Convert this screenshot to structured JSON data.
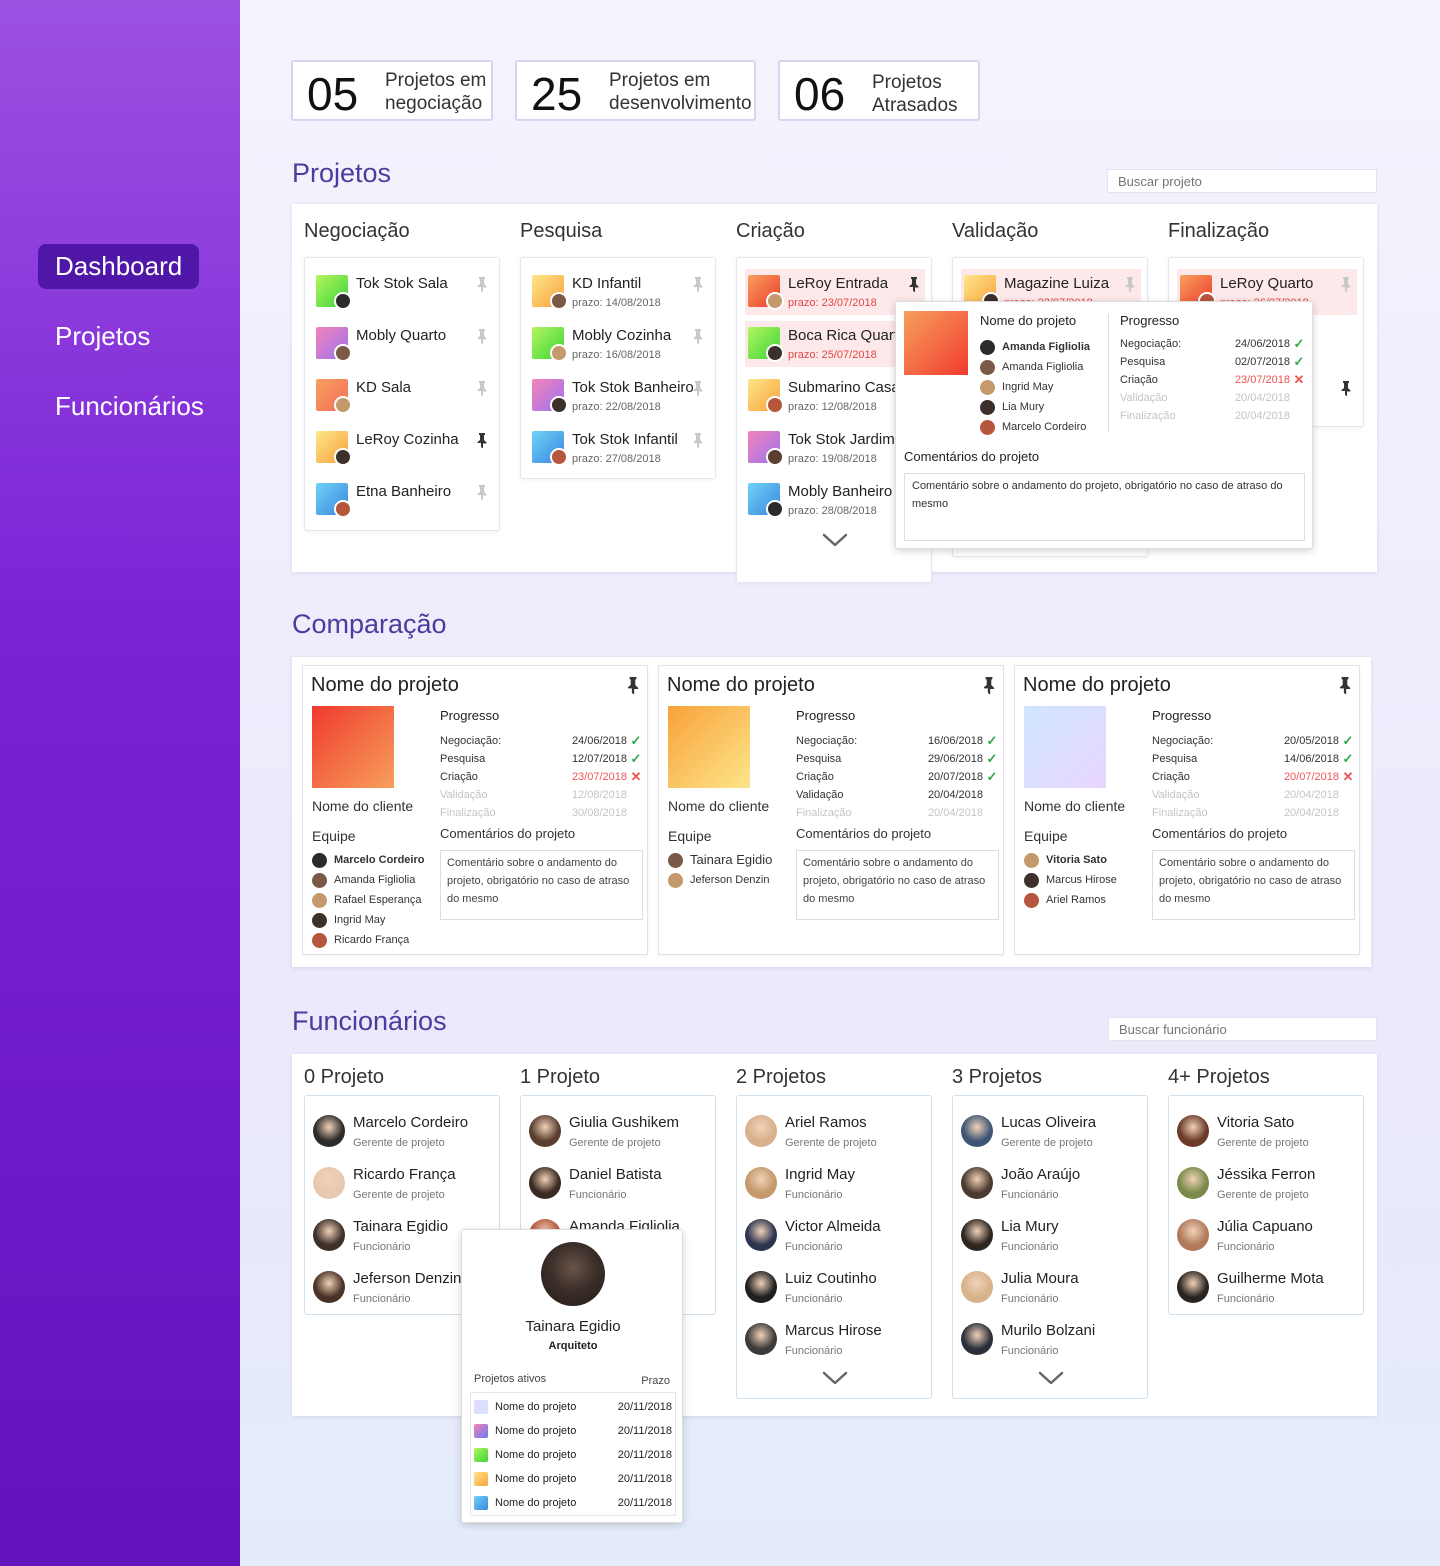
{
  "sidebar": {
    "items": [
      {
        "label": "Dashboard",
        "active": true
      },
      {
        "label": "Projetos",
        "active": false
      },
      {
        "label": "Funcionários",
        "active": false
      }
    ]
  },
  "stats": [
    {
      "value": "05",
      "label": "Projetos em\nnegociação"
    },
    {
      "value": "25",
      "label": "Projetos em\ndesenvolvimento"
    },
    {
      "value": "06",
      "label": "Projetos\nAtrasados"
    }
  ],
  "projetos": {
    "title": "Projetos",
    "search_placeholder": "Buscar projeto",
    "columns": [
      {
        "title": "Negociação",
        "items": [
          {
            "name": "Tok Stok Sala",
            "date": "",
            "late": false,
            "pinned": false,
            "thumb": "#b4f55e",
            "thumb2": "#3dd43b"
          },
          {
            "name": "Mobly Quarto",
            "date": "",
            "late": false,
            "pinned": false,
            "thumb": "#f583b8",
            "thumb2": "#9b73f0"
          },
          {
            "name": "KD Sala",
            "date": "",
            "late": false,
            "pinned": false,
            "thumb": "#f7a05c",
            "thumb2": "#f26d5b"
          },
          {
            "name": "LeRoy Cozinha",
            "date": "",
            "late": false,
            "pinned": true,
            "thumb": "#fde68a",
            "thumb2": "#f9a13a"
          },
          {
            "name": "Etna Banheiro",
            "date": "",
            "late": false,
            "pinned": false,
            "thumb": "#6fd3f5",
            "thumb2": "#3a86e0"
          }
        ]
      },
      {
        "title": "Pesquisa",
        "items": [
          {
            "name": "KD Infantil",
            "date": "prazo: 14/08/2018",
            "late": false,
            "pinned": false,
            "thumb": "#fde68a",
            "thumb2": "#f9a13a"
          },
          {
            "name": "Mobly Cozinha",
            "date": "prazo: 16/08/2018",
            "late": false,
            "pinned": false,
            "thumb": "#b4f55e",
            "thumb2": "#3dd43b"
          },
          {
            "name": "Tok Stok Banheiro",
            "date": "prazo: 22/08/2018",
            "late": false,
            "pinned": false,
            "thumb": "#f583b8",
            "thumb2": "#9b73f0"
          },
          {
            "name": "Tok Stok Infantil",
            "date": "prazo: 27/08/2018",
            "late": false,
            "pinned": false,
            "thumb": "#6fd3f5",
            "thumb2": "#3a86e0"
          }
        ]
      },
      {
        "title": "Criação",
        "items": [
          {
            "name": "LeRoy Entrada",
            "date": "prazo: 23/07/2018",
            "late": true,
            "pinned": true,
            "thumb": "#f7a05c",
            "thumb2": "#f03a2e"
          },
          {
            "name": "Boca Rica Quarto",
            "date": "prazo: 25/07/2018",
            "late": true,
            "pinned": false,
            "thumb": "#b4f55e",
            "thumb2": "#3dd43b"
          },
          {
            "name": "Submarino Casa",
            "date": "prazo: 12/08/2018",
            "late": false,
            "pinned": false,
            "thumb": "#fde68a",
            "thumb2": "#f9a13a"
          },
          {
            "name": "Tok Stok Jardim",
            "date": "prazo: 19/08/2018",
            "late": false,
            "pinned": false,
            "thumb": "#f583b8",
            "thumb2": "#9b73f0"
          },
          {
            "name": "Mobly Banheiro",
            "date": "prazo: 28/08/2018",
            "late": false,
            "pinned": false,
            "thumb": "#6fd3f5",
            "thumb2": "#3a86e0"
          }
        ]
      },
      {
        "title": "Validação",
        "items": [
          {
            "name": "Magazine Luiza",
            "date": "prazo: 22/07/2018",
            "late": true,
            "pinned": false,
            "thumb": "#fde68a",
            "thumb2": "#f9a13a"
          }
        ]
      },
      {
        "title": "Finalização",
        "items": [
          {
            "name": "LeRoy Quarto",
            "date": "prazo: 26/07/2018",
            "late": true,
            "pinned": false,
            "thumb": "#f7a05c",
            "thumb2": "#f03a2e"
          },
          {
            "name": "",
            "date": "",
            "late": false,
            "pinned": false,
            "thumb": "#ffffff",
            "thumb2": "#ffffff"
          },
          {
            "name": "…ala",
            "date": "",
            "late": false,
            "pinned": true,
            "thumb": "#ffffff",
            "thumb2": "#ffffff"
          }
        ]
      }
    ],
    "popup": {
      "name_label": "Nome do projeto",
      "team": [
        {
          "name": "Amanda Figliolia",
          "bold": true
        },
        {
          "name": "Amanda Figliolia",
          "bold": false
        },
        {
          "name": "Ingrid May",
          "bold": false
        },
        {
          "name": "Lia Mury",
          "bold": false
        },
        {
          "name": "Marcelo Cordeiro",
          "bold": false
        }
      ],
      "progress_label": "Progresso",
      "progress": [
        {
          "step": "Negociação:",
          "date": "24/06/2018",
          "status": "ok"
        },
        {
          "step": "Pesquisa",
          "date": "02/07/2018",
          "status": "ok"
        },
        {
          "step": "Criação",
          "date": "23/07/2018",
          "status": "late"
        },
        {
          "step": "Validação",
          "date": "20/04/2018",
          "status": "pending"
        },
        {
          "step": "Finalização",
          "date": "20/04/2018",
          "status": "pending"
        }
      ],
      "comments_label": "Comentários do projeto",
      "comment": "Comentário sobre o andamento do projeto, obrigatório no caso de atraso do mesmo"
    }
  },
  "comparacao": {
    "title": "Comparação",
    "cards": [
      {
        "name": "Nome do projeto",
        "client": "Nome do cliente",
        "team_label": "Equipe",
        "progress_label": "Progresso",
        "comments_label": "Comentários do projeto",
        "thumb": "#f7a05c",
        "thumb2": "#f03a2e",
        "progress": [
          {
            "step": "Negociação:",
            "date": "24/06/2018",
            "status": "ok"
          },
          {
            "step": "Pesquisa",
            "date": "12/07/2018",
            "status": "ok"
          },
          {
            "step": "Criação",
            "date": "23/07/2018",
            "status": "late"
          },
          {
            "step": "Validação",
            "date": "12/08/2018",
            "status": "pending"
          },
          {
            "step": "Finalização",
            "date": "30/08/2018",
            "status": "pending"
          }
        ],
        "team": [
          {
            "name": "Marcelo Cordeiro",
            "bold": true
          },
          {
            "name": "Amanda Figliolia",
            "bold": false
          },
          {
            "name": "Rafael Esperança",
            "bold": false
          },
          {
            "name": "Ingrid May",
            "bold": false
          },
          {
            "name": "Ricardo França",
            "bold": false
          }
        ],
        "comment": "Comentário sobre o andamento do projeto, obrigatório no caso de atraso do mesmo"
      },
      {
        "name": "Nome do projeto",
        "client": "Nome do cliente",
        "team_label": "Equipe",
        "progress_label": "Progresso",
        "comments_label": "Comentários do projeto",
        "thumb": "#fde68a",
        "thumb2": "#f9a13a",
        "progress": [
          {
            "step": "Negociação:",
            "date": "16/06/2018",
            "status": "ok"
          },
          {
            "step": "Pesquisa",
            "date": "29/06/2018",
            "status": "ok"
          },
          {
            "step": "Criação",
            "date": "20/07/2018",
            "status": "ok"
          },
          {
            "step": "Validação",
            "date": "20/04/2018",
            "status": "active"
          },
          {
            "step": "Finalização",
            "date": "20/04/2018",
            "status": "pending"
          }
        ],
        "team": [
          {
            "name": "Tainara Egidio",
            "bold": false
          },
          {
            "name": "Jeferson Denzin",
            "bold": false
          }
        ],
        "comment": "Comentário sobre o andamento do projeto, obrigatório no caso de atraso do mesmo"
      },
      {
        "name": "Nome do projeto",
        "client": "Nome do cliente",
        "team_label": "Equipe",
        "progress_label": "Progresso",
        "comments_label": "Comentários do projeto",
        "thumb": "#e8d6ff",
        "thumb2": "#cfe6ff",
        "progress": [
          {
            "step": "Negociação:",
            "date": "20/05/2018",
            "status": "ok"
          },
          {
            "step": "Pesquisa",
            "date": "14/06/2018",
            "status": "ok"
          },
          {
            "step": "Criação",
            "date": "20/07/2018",
            "status": "late"
          },
          {
            "step": "Validação",
            "date": "20/04/2018",
            "status": "pending"
          },
          {
            "step": "Finalização",
            "date": "20/04/2018",
            "status": "pending"
          }
        ],
        "team": [
          {
            "name": "Vitoria Sato",
            "bold": true
          },
          {
            "name": "Marcus Hirose",
            "bold": false
          },
          {
            "name": "Ariel Ramos",
            "bold": false
          }
        ],
        "comment": "Comentário sobre o andamento do projeto, obrigatório no caso de atraso do mesmo"
      }
    ]
  },
  "funcionarios": {
    "title": "Funcionários",
    "search_placeholder": "Buscar funcionário",
    "columns": [
      {
        "title": "0 Projeto",
        "more": false,
        "employees": [
          {
            "name": "Marcelo Cordeiro",
            "role": "Gerente de projeto",
            "color": "#2b2b2b"
          },
          {
            "name": "Ricardo França",
            "role": "Gerente de projeto",
            "color": "#e8c9b0"
          },
          {
            "name": "Tainara Egidio",
            "role": "Funcionário",
            "color": "#3d2f2a"
          },
          {
            "name": "Jeferson Denzin",
            "role": "Funcionário",
            "color": "#4a3226"
          }
        ]
      },
      {
        "title": "1 Projeto",
        "more": false,
        "employees": [
          {
            "name": "Giulia Gushikem",
            "role": "Gerente de projeto",
            "color": "#5a3e30"
          },
          {
            "name": "Daniel Batista",
            "role": "Funcionário",
            "color": "#3a2a22"
          },
          {
            "name": "Amanda Figliolia",
            "role": "Funcionário",
            "color": "#b6563c"
          },
          {
            "name": "",
            "role": "",
            "color": "#cccccc"
          }
        ]
      },
      {
        "title": "2 Projetos",
        "more": true,
        "employees": [
          {
            "name": "Ariel Ramos",
            "role": "Gerente de projeto",
            "color": "#d9b08c"
          },
          {
            "name": "Ingrid May",
            "role": "Funcionário",
            "color": "#c49a6c"
          },
          {
            "name": "Victor Almeida",
            "role": "Funcionário",
            "color": "#2c3550"
          },
          {
            "name": "Luiz Coutinho",
            "role": "Funcionário",
            "color": "#1f1f1f"
          },
          {
            "name": "Marcus Hirose",
            "role": "Funcionário",
            "color": "#3b3b3b"
          }
        ]
      },
      {
        "title": "3 Projetos",
        "more": true,
        "employees": [
          {
            "name": "Lucas Oliveira",
            "role": "Gerente de projeto",
            "color": "#3e5675"
          },
          {
            "name": "João Araújo",
            "role": "Funcionário",
            "color": "#4b3a30"
          },
          {
            "name": "Lia Mury",
            "role": "Funcionário",
            "color": "#2d2520"
          },
          {
            "name": "Julia Moura",
            "role": "Funcionário",
            "color": "#d8b28a"
          },
          {
            "name": "Murilo Bolzani",
            "role": "Funcionário",
            "color": "#2b2f3a"
          }
        ]
      },
      {
        "title": "4+ Projetos",
        "more": false,
        "employees": [
          {
            "name": "Vitoria Sato",
            "role": "Gerente de projeto",
            "color": "#6b3a28"
          },
          {
            "name": "Jéssika Ferron",
            "role": "Gerente de projeto",
            "color": "#7a8a4a"
          },
          {
            "name": "Júlia Capuano",
            "role": "Funcionário",
            "color": "#b07a5a"
          },
          {
            "name": "Guilherme Mota",
            "role": "Funcionário",
            "color": "#2a2420"
          }
        ]
      }
    ],
    "tooltip": {
      "name": "Tainara Egidio",
      "role": "Arquiteto",
      "active_label": "Projetos ativos",
      "deadline_label": "Prazo",
      "projects": [
        {
          "name": "Nome do projeto",
          "date": "20/11/2018",
          "color": "#e8d6ff",
          "color2": "#cfe6ff"
        },
        {
          "name": "Nome do projeto",
          "date": "20/11/2018",
          "color": "#f583b8",
          "color2": "#6a7bf0"
        },
        {
          "name": "Nome do projeto",
          "date": "20/11/2018",
          "color": "#b4f55e",
          "color2": "#3dd43b"
        },
        {
          "name": "Nome do projeto",
          "date": "20/11/2018",
          "color": "#fde68a",
          "color2": "#f9a13a"
        },
        {
          "name": "Nome do projeto",
          "date": "20/11/2018",
          "color": "#6fd3f5",
          "color2": "#3a86e0"
        }
      ]
    }
  }
}
